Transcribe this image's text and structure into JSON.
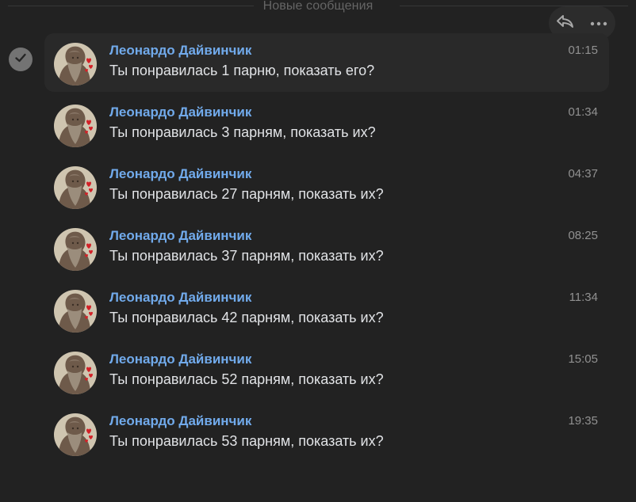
{
  "divider": {
    "label": "Новые сообщения"
  },
  "toolbar": {
    "reply_icon": "reply-icon",
    "more_icon": "more-icon"
  },
  "selection": {
    "icon": "checkmark-icon"
  },
  "colors": {
    "background": "#222222",
    "author": "#71aaeb",
    "text": "#e1e3e6",
    "time": "#919191"
  },
  "messages": [
    {
      "author": "Леонардо Дайвинчик",
      "time": "01:15",
      "text": "Ты понравилась 1 парню, показать его?",
      "selected": true
    },
    {
      "author": "Леонардо Дайвинчик",
      "time": "01:34",
      "text": "Ты понравилась 3 парням, показать их?",
      "selected": false
    },
    {
      "author": "Леонардо Дайвинчик",
      "time": "04:37",
      "text": "Ты понравилась 27 парням, показать их?",
      "selected": false
    },
    {
      "author": "Леонардо Дайвинчик",
      "time": "08:25",
      "text": "Ты понравилась 37 парням, показать их?",
      "selected": false
    },
    {
      "author": "Леонардо Дайвинчик",
      "time": "11:34",
      "text": "Ты понравилась 42 парням, показать их?",
      "selected": false
    },
    {
      "author": "Леонардо Дайвинчик",
      "time": "15:05",
      "text": "Ты понравилась 52 парням, показать их?",
      "selected": false
    },
    {
      "author": "Леонардо Дайвинчик",
      "time": "19:35",
      "text": "Ты понравилась 53 парням, показать их?",
      "selected": false
    }
  ]
}
